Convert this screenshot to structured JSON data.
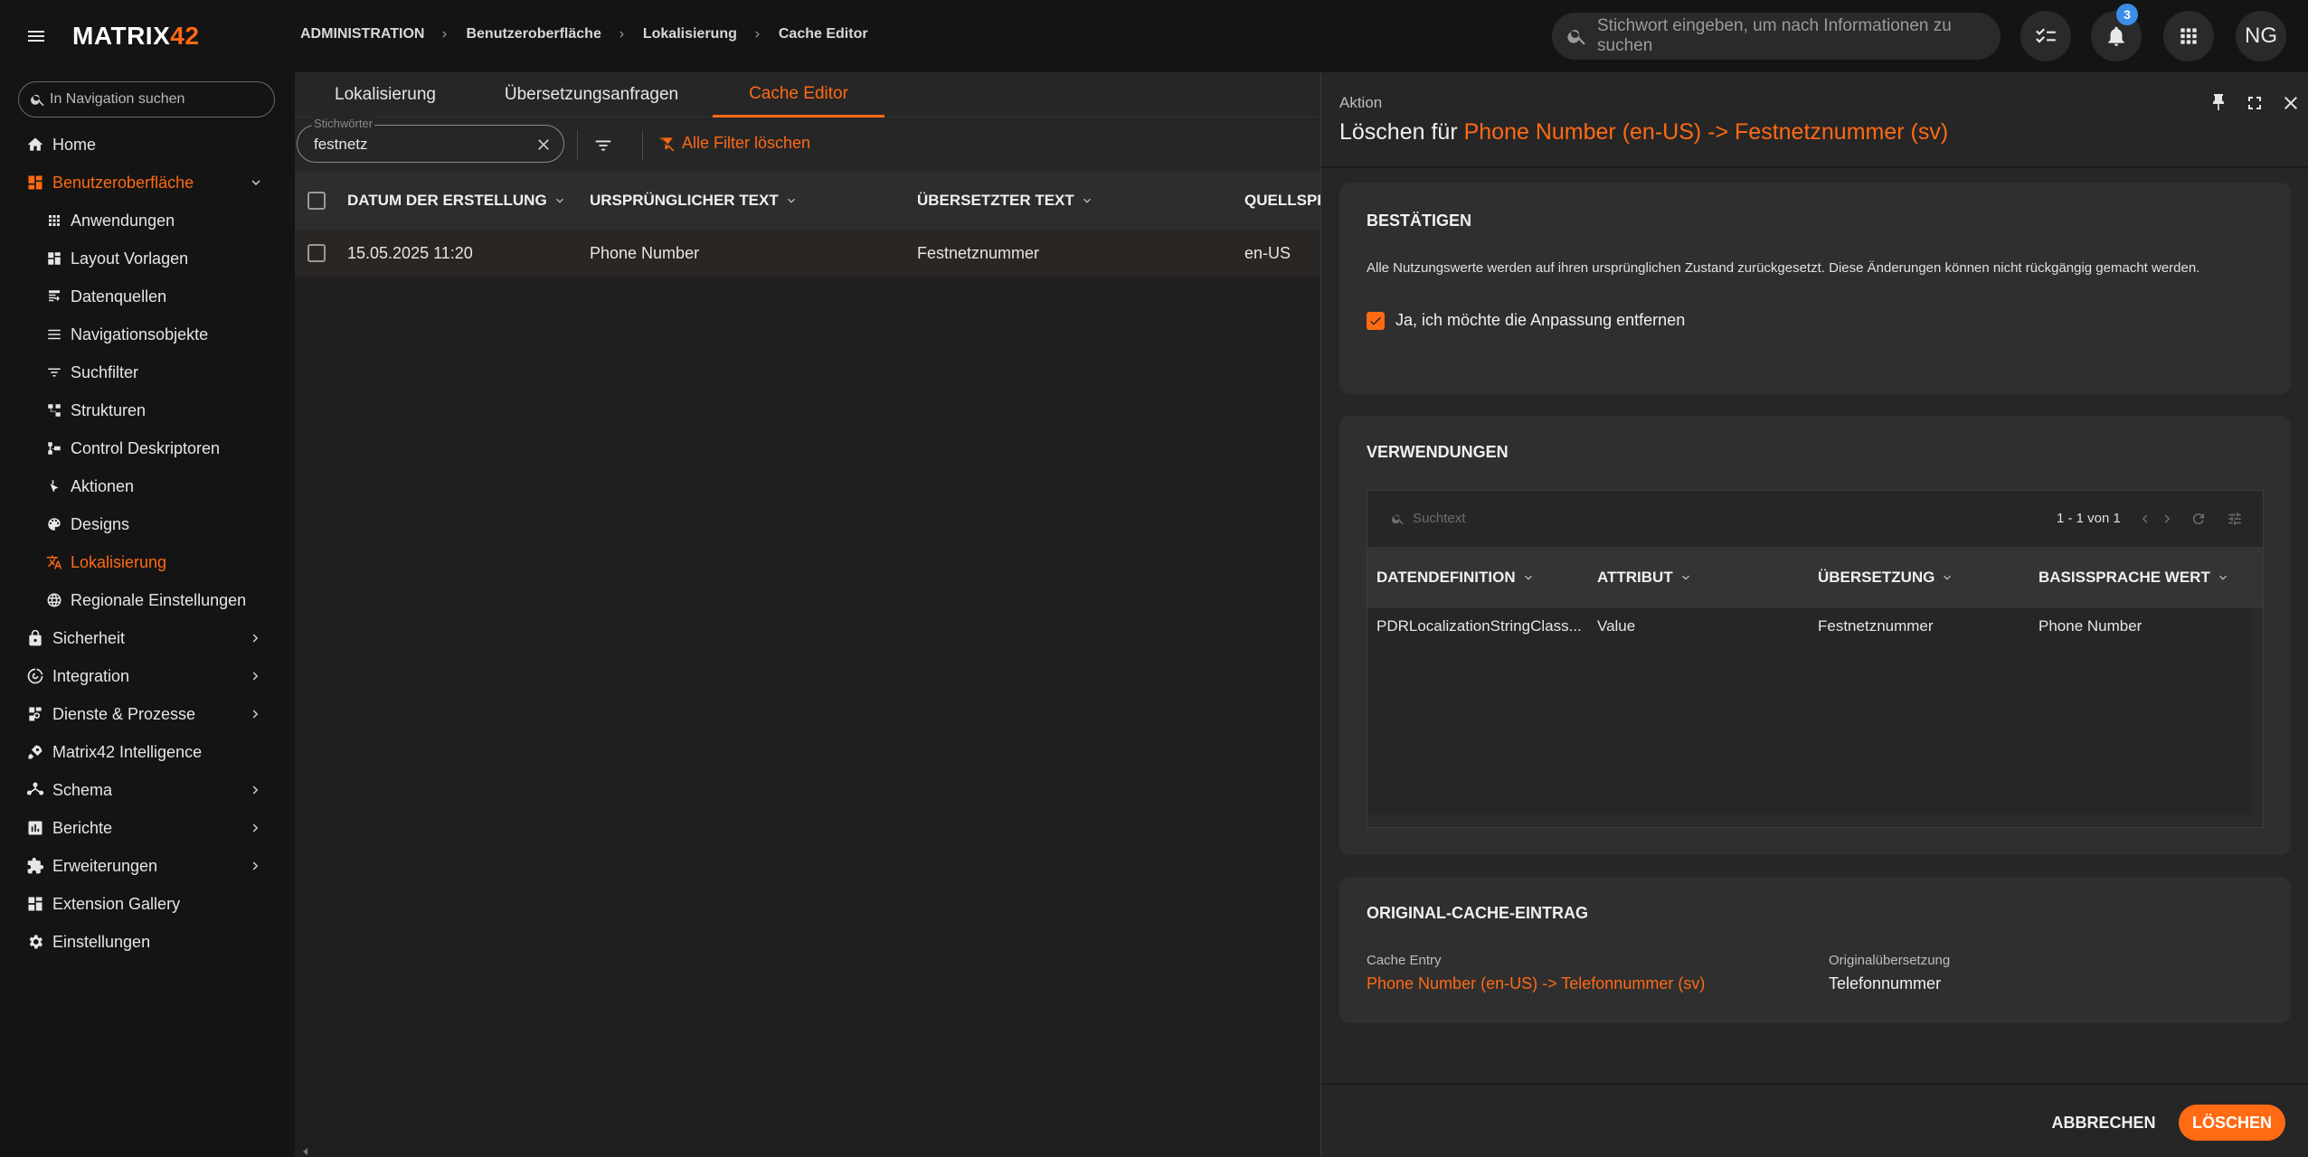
{
  "app": {
    "logo_text": "MATRIX",
    "logo_num": "42"
  },
  "breadcrumb": [
    "ADMINISTRATION",
    "Benutzeroberfläche",
    "Lokalisierung",
    "Cache Editor"
  ],
  "global_search": {
    "placeholder": "Stichwort eingeben, um nach Informationen zu suchen"
  },
  "topbar": {
    "notification_count": "3",
    "avatar_initials": "NG"
  },
  "sidebar": {
    "search_placeholder": "In Navigation suchen",
    "items": [
      {
        "label": "Home",
        "icon": "home-icon"
      },
      {
        "label": "Benutzeroberfläche",
        "icon": "dashboard-icon",
        "expanded": true,
        "active": true
      },
      {
        "label": "Anwendungen",
        "icon": "apps-icon"
      },
      {
        "label": "Layout Vorlagen",
        "icon": "layout-icon"
      },
      {
        "label": "Datenquellen",
        "icon": "datasource-icon"
      },
      {
        "label": "Navigationsobjekte",
        "icon": "list-icon"
      },
      {
        "label": "Suchfilter",
        "icon": "filter-icon"
      },
      {
        "label": "Strukturen",
        "icon": "structure-icon"
      },
      {
        "label": "Control Deskriptoren",
        "icon": "descriptor-icon"
      },
      {
        "label": "Aktionen",
        "icon": "action-icon"
      },
      {
        "label": "Designs",
        "icon": "palette-icon"
      },
      {
        "label": "Lokalisierung",
        "icon": "translate-icon",
        "active": true
      },
      {
        "label": "Regionale Einstellungen",
        "icon": "globe-icon"
      },
      {
        "label": "Sicherheit",
        "icon": "lock-icon"
      },
      {
        "label": "Integration",
        "icon": "integration-icon"
      },
      {
        "label": "Dienste & Prozesse",
        "icon": "services-icon"
      },
      {
        "label": "Matrix42 Intelligence",
        "icon": "rocket-icon"
      },
      {
        "label": "Schema",
        "icon": "schema-icon"
      },
      {
        "label": "Berichte",
        "icon": "report-icon"
      },
      {
        "label": "Erweiterungen",
        "icon": "puzzle-icon"
      },
      {
        "label": "Extension Gallery",
        "icon": "gallery-icon"
      },
      {
        "label": "Einstellungen",
        "icon": "gear-icon"
      }
    ]
  },
  "main": {
    "tabs": [
      {
        "label": "Lokalisierung"
      },
      {
        "label": "Übersetzungsanfragen"
      },
      {
        "label": "Cache Editor",
        "active": true
      }
    ],
    "keyword_label": "Stichwörter",
    "keyword_value": "festnetz",
    "clear_filters": "Alle Filter löschen",
    "columns": [
      "DATUM DER ERSTELLUNG",
      "URSPRÜNGLICHER TEXT",
      "ÜBERSETZTER TEXT",
      "QUELLSPR"
    ],
    "rows": [
      {
        "date": "15.05.2025 11:20",
        "original": "Phone Number",
        "translated": "Festnetznummer",
        "source_lang": "en-US"
      }
    ]
  },
  "panel": {
    "overline": "Aktion",
    "title_prefix": "Löschen für ",
    "title_entry": "Phone Number (en-US) -> Festnetznummer (sv)",
    "confirm": {
      "title": "BESTÄTIGEN",
      "text": "Alle Nutzungswerte werden auf ihren ursprünglichen Zustand zurückgesetzt. Diese Änderungen können nicht rückgängig gemacht werden.",
      "checkbox_label": "Ja, ich möchte die Anpassung entfernen",
      "checked": true
    },
    "usages": {
      "title": "VERWENDUNGEN",
      "search_placeholder": "Suchtext",
      "pager": "1 - 1 von 1",
      "columns": [
        "DATENDEFINITION",
        "ATTRIBUT",
        "ÜBERSETZUNG",
        "BASISSPRACHE WERT"
      ],
      "rows": [
        {
          "definition": "PDRLocalizationStringClass...",
          "attribute": "Value",
          "translation": "Festnetznummer",
          "base_value": "Phone Number"
        }
      ]
    },
    "original": {
      "title": "ORIGINAL-CACHE-EINTRAG",
      "entry_label": "Cache Entry",
      "entry_value": "Phone Number (en-US) -> Telefonnummer (sv)",
      "translation_label": "Originalübersetzung",
      "translation_value": "Telefonnummer"
    },
    "cancel_label": "ABBRECHEN",
    "delete_label": "LÖSCHEN"
  },
  "colors": {
    "accent": "#ff6a13",
    "badge": "#3b8ee8"
  }
}
